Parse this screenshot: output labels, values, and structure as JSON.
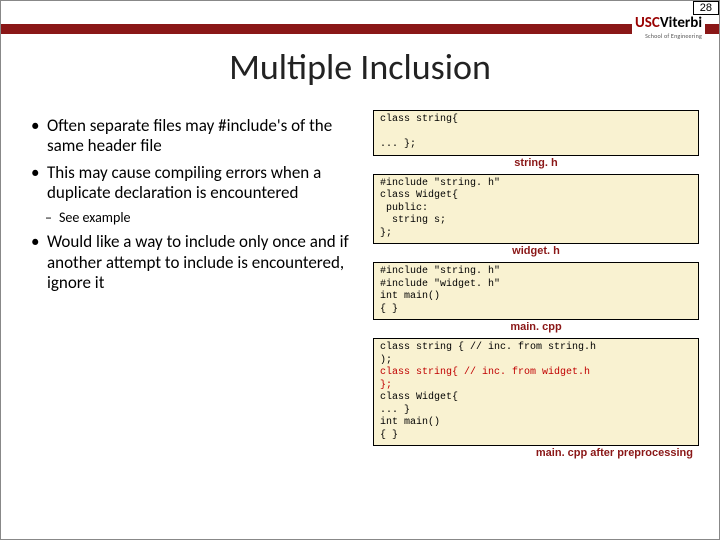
{
  "page_number": "28",
  "logo": {
    "usc": "USC",
    "viterbi": "Viterbi",
    "sub": "School of Engineering"
  },
  "title": "Multiple Inclusion",
  "bullets": {
    "b1": "Often separate files may #include's of the same header file",
    "b2": "This may cause compiling errors when a duplicate declaration is encountered",
    "b2_sub": "See example",
    "b3": "Would like a way to include only once and if another attempt to include is encountered, ignore it"
  },
  "code": {
    "box1": "class string{\n\n... };",
    "label1": "string. h",
    "box2": "#include \"string. h\"\nclass Widget{\n public:\n  string s;\n};",
    "label2": "widget. h",
    "box3": "#include \"string. h\"\n#include \"widget. h\"\nint main()\n{ }",
    "label3": "main. cpp",
    "box4_l1": "class string { // inc. from string.h",
    "box4_l2": ");",
    "box4_l3": "class string{ // inc. from widget.h\n};",
    "box4_l4": "class Widget{\n... }\nint main()\n{ }",
    "label4": "main. cpp after preprocessing"
  }
}
